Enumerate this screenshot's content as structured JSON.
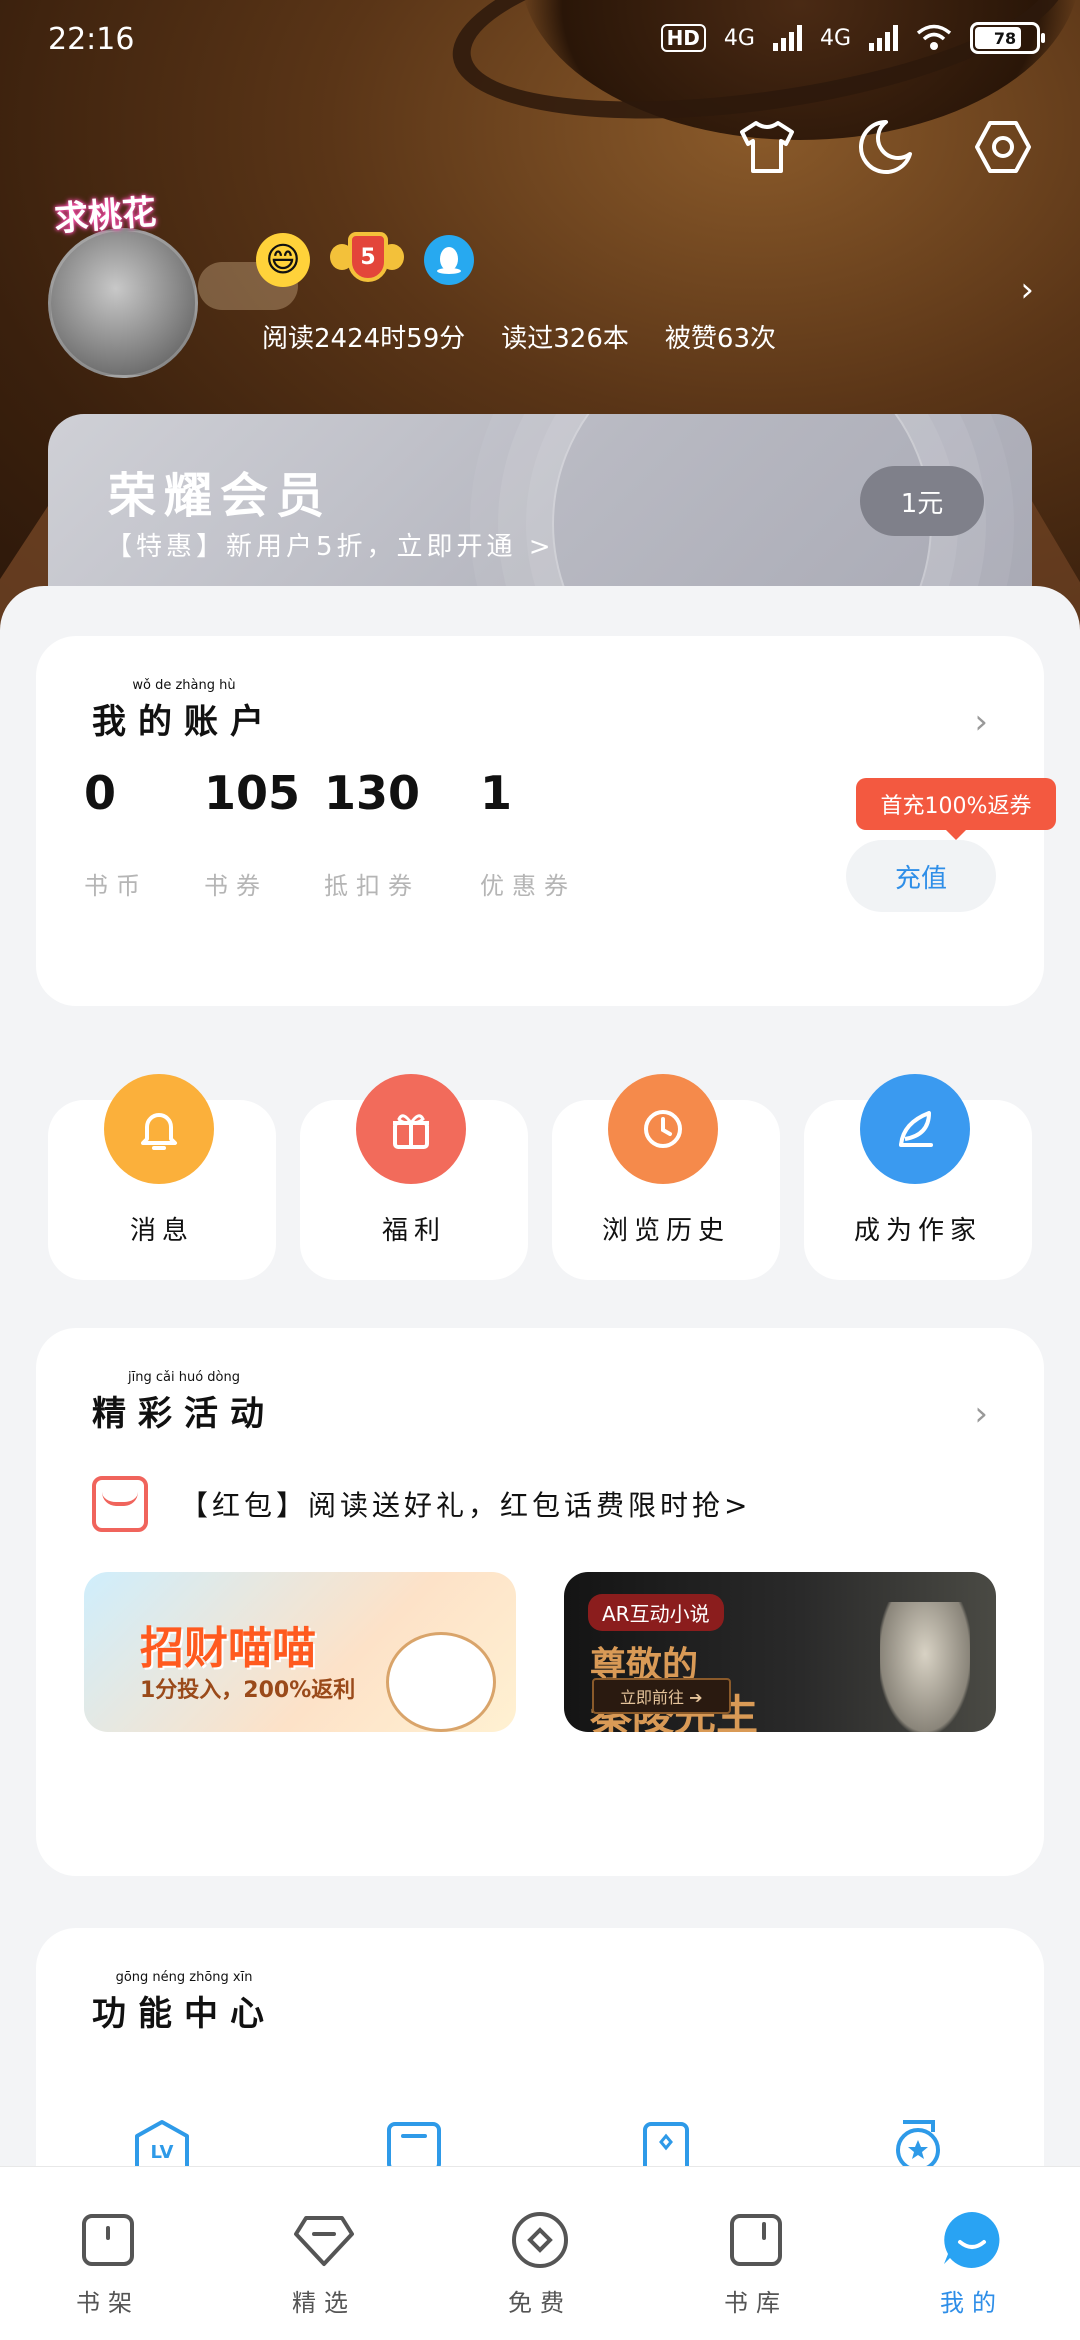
{
  "status_bar": {
    "time": "22:16",
    "network_badge": "HD",
    "signal1_label": "4G",
    "signal2_label": "4G",
    "battery": "78"
  },
  "profile": {
    "avatar_tag": "求桃花",
    "stats": [
      "阅读2424时59分",
      "读过326本",
      "被赞63次"
    ]
  },
  "vip": {
    "title": "荣耀会员",
    "subtitle": "【特惠】新用户5折，立即开通 >",
    "button": "1元"
  },
  "account": {
    "title": "我的账户",
    "title_pinyin": "wǒ de zhàng hù",
    "items": [
      {
        "value": "0",
        "label": "书币"
      },
      {
        "value": "105",
        "label": "书券"
      },
      {
        "value": "130",
        "label": "抵扣券"
      },
      {
        "value": "1",
        "label": "优惠券"
      }
    ],
    "recharge_tag": "首充100%返券",
    "recharge_button": "充值"
  },
  "shortcuts": [
    {
      "label": "消息",
      "color": "#fbb03b",
      "icon": "bell-icon"
    },
    {
      "label": "福利",
      "color": "#f26b5b",
      "icon": "gift-icon"
    },
    {
      "label": "浏览历史",
      "color": "#f58a4b",
      "icon": "clock-icon"
    },
    {
      "label": "成为作家",
      "color": "#3a9af0",
      "icon": "feather-icon"
    }
  ],
  "activities": {
    "title": "精彩活动",
    "title_pinyin": "jīng cǎi huó dòng",
    "promo_text": "【红包】阅读送好礼，红包话费限时抢>",
    "banner1_title": "招财喵喵",
    "banner1_sub": "1分投入，200%返利",
    "banner2_tag": "AR互动小说",
    "banner2_title1": "尊敬的",
    "banner2_title2": "秦陵先生",
    "banner2_button": "立即前往 ➔"
  },
  "functions": {
    "title": "功能中心",
    "title_pinyin": "gōng néng zhōng xīn"
  },
  "bottom_nav": [
    {
      "label": "书架",
      "icon": "bookshelf-icon"
    },
    {
      "label": "精选",
      "icon": "featured-icon"
    },
    {
      "label": "免费",
      "icon": "free-icon"
    },
    {
      "label": "书库",
      "icon": "library-icon"
    },
    {
      "label": "我的",
      "icon": "profile-icon",
      "active": true
    }
  ]
}
